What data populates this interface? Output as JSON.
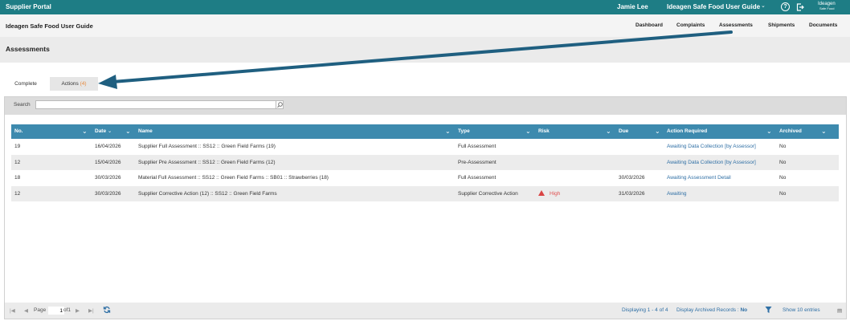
{
  "topbar": {
    "portal_label": "Supplier Portal",
    "user_name": "Jamie Lee",
    "guide_name": "Ideagen Safe Food User Guide",
    "logo_text": "Ideagen",
    "logo_sub": "Safe Food"
  },
  "navbar": {
    "title": "Ideagen Safe Food User Guide",
    "links": [
      "Dashboard",
      "Complaints",
      "Assessments",
      "Shipments",
      "Documents"
    ]
  },
  "page": {
    "heading": "Assessments"
  },
  "tabs": {
    "complete_label": "Complete",
    "actions_label": "Actions",
    "actions_count": "(4)"
  },
  "search": {
    "label": "Search",
    "value": ""
  },
  "table": {
    "columns": [
      "No.",
      "Date",
      "Name",
      "Type",
      "Risk",
      "Due",
      "Action Required",
      "Archived"
    ],
    "rows": [
      {
        "no": "19",
        "date": "16/04/2026",
        "name": "Supplier Full Assessment :: SS12 :: Green Field Farms (19)",
        "type": "Full Assessment",
        "risk": "",
        "due": "",
        "action": "Awaiting Data Collection [by Assessor]",
        "archived": "No"
      },
      {
        "no": "12",
        "date": "15/04/2026",
        "name": "Supplier Pre Assessment :: SS12 :: Green Field Farms (12)",
        "type": "Pre-Assessment",
        "risk": "",
        "due": "",
        "action": "Awaiting Data Collection [by Assessor]",
        "archived": "No"
      },
      {
        "no": "18",
        "date": "30/03/2026",
        "name": "Material Full Assessment :: SS12 :: Green Field Farms :: SB01 :: Strawberries (18)",
        "type": "Full Assessment",
        "risk": "",
        "due": "30/03/2026",
        "action": "Awaiting Assessment Detail",
        "archived": "No"
      },
      {
        "no": "12",
        "date": "30/03/2026",
        "name": "Supplier Corrective Action (12) :: SS12 :: Green Field Farms",
        "type": "Supplier Corrective Action",
        "risk": "High",
        "due": "31/03/2026",
        "action": "Awaiting",
        "archived": "No"
      }
    ]
  },
  "footer": {
    "page_label": "Page",
    "page_value": "1",
    "page_of": "of1",
    "displaying": "Displaying 1 - 4 of 4",
    "archived_label": "Display Archived Records :",
    "archived_value": "No",
    "show_entries": "Show 10 entries"
  },
  "colors": {
    "topbar": "#1e7d85",
    "table_header": "#3d8aae",
    "link": "#2f6fa5",
    "risk_high": "#e05050",
    "tab_count": "#e6873a",
    "annotation_arrow": "#1f5f80"
  }
}
